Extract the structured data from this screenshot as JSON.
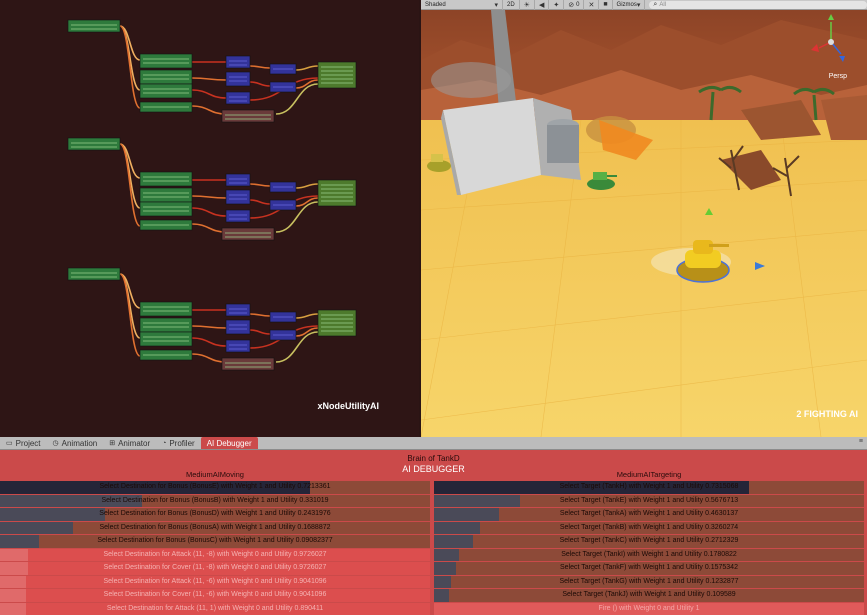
{
  "graph": {
    "title": "xNodeUtilityAI"
  },
  "scene": {
    "toolbar": {
      "shaded": "Shaded",
      "mode_2d": "2D",
      "count": "0",
      "gizmos": "Gizmos",
      "search": "All"
    },
    "persp": "Persp",
    "title": "2 FIGHTING AI"
  },
  "tabs": [
    {
      "label": "Project",
      "icon": "folder-icon"
    },
    {
      "label": "Animation",
      "icon": "clock-icon"
    },
    {
      "label": "Animator",
      "icon": "animator-icon"
    },
    {
      "label": "Profiler",
      "icon": "profiler-icon"
    },
    {
      "label": "AI Debugger",
      "icon": ""
    }
  ],
  "debugger": {
    "brain": "Brain of TankD",
    "title": "AI DEBUGGER",
    "left": {
      "title": "MediumAIMoving",
      "rows": [
        {
          "text": "Select Destination for Bonus (BonusE) with Weight 1 and Utility 0.7213361",
          "utility": 0.7213,
          "state": "hi"
        },
        {
          "text": "Select Destination for Bonus (BonusB) with Weight 1 and Utility 0.331019",
          "utility": 0.331,
          "state": "on"
        },
        {
          "text": "Select Destination for Bonus (BonusD) with Weight 1 and Utility 0.2431976",
          "utility": 0.2432,
          "state": "on"
        },
        {
          "text": "Select Destination for Bonus (BonusA) with Weight 1 and Utility 0.1688872",
          "utility": 0.1689,
          "state": "on"
        },
        {
          "text": "Select Destination for Bonus (BonusC) with Weight 1 and Utility 0.09082377",
          "utility": 0.0908,
          "state": "on"
        },
        {
          "text": "Select Destination for Attack (11, -8) with Weight 0 and Utility 0.9726027",
          "utility": 0.0651,
          "state": "dim"
        },
        {
          "text": "Select Destination for Cover (11, -8) with Weight 0 and Utility 0.9726027",
          "utility": 0.0651,
          "state": "dim"
        },
        {
          "text": "Select Destination for Attack (11, -6) with Weight 0 and Utility 0.9041096",
          "utility": 0.0605,
          "state": "dim"
        },
        {
          "text": "Select Destination for Cover (11, -6) with Weight 0 and Utility 0.9041096",
          "utility": 0.0605,
          "state": "dim"
        },
        {
          "text": "Select Destination for Attack (11, 1) with Weight 0 and Utility 0.890411",
          "utility": 0.0596,
          "state": "dim"
        }
      ]
    },
    "right": {
      "title": "MediumAITargeting",
      "rows": [
        {
          "text": "Select Target (TankH) with Weight 1 and Utility 0.7315068",
          "utility": 0.7315,
          "state": "hi"
        },
        {
          "text": "Select Target (TankE) with Weight 1 and Utility 0.5676713",
          "utility": 0.2,
          "state": "on"
        },
        {
          "text": "Select Target (TankA) with Weight 1 and Utility 0.4630137",
          "utility": 0.15,
          "state": "on"
        },
        {
          "text": "Select Target (TankB) with Weight 1 and Utility 0.3260274",
          "utility": 0.107,
          "state": "on"
        },
        {
          "text": "Select Target (TankC) with Weight 1 and Utility 0.2712329",
          "utility": 0.09,
          "state": "on"
        },
        {
          "text": "Select Target (TankI) with Weight 1 and Utility 0.1780822",
          "utility": 0.058,
          "state": "on"
        },
        {
          "text": "Select Target (TankF) with Weight 1 and Utility 0.1575342",
          "utility": 0.052,
          "state": "on"
        },
        {
          "text": "Select Target (TankG) with Weight 1 and Utility 0.1232877",
          "utility": 0.04,
          "state": "on"
        },
        {
          "text": "Select Target (TankJ) with Weight 1 and Utility 0.109589",
          "utility": 0.036,
          "state": "on"
        },
        {
          "text": "Fire () with Weight 0 and Utility 1",
          "utility": 0,
          "state": "faint"
        }
      ]
    }
  },
  "colors": {
    "panel": "#cb4a4a",
    "graph_bg": "#2e1515",
    "node_green": "#2e7a3c",
    "node_blue": "#33339a",
    "node_brown": "#6a3a3a"
  }
}
